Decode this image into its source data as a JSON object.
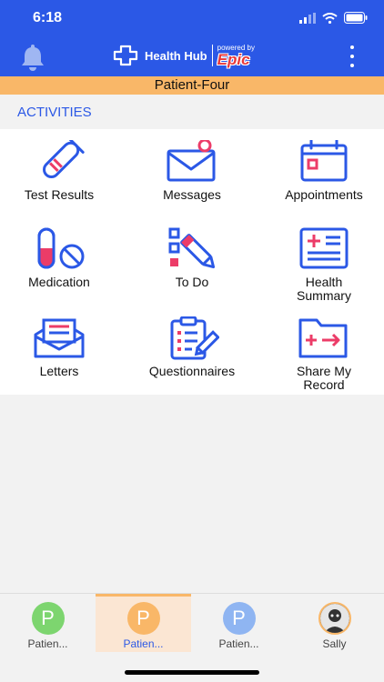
{
  "status_bar": {
    "time": "6:18"
  },
  "header": {
    "app_name": "Health Hub",
    "powered_by": "powered by",
    "brand": "Epic",
    "bell_icon": "bell-icon",
    "menu_icon": "kebab-menu-icon"
  },
  "patient_banner": {
    "name": "Patient-Four"
  },
  "section": {
    "title": "ACTIVITIES"
  },
  "activities": [
    {
      "label": "Test Results",
      "icon": "test-tube-icon"
    },
    {
      "label": "Messages",
      "icon": "envelope-icon"
    },
    {
      "label": "Appointments",
      "icon": "calendar-icon"
    },
    {
      "label": "Medication",
      "icon": "pill-icon"
    },
    {
      "label": "To Do",
      "icon": "checklist-icon"
    },
    {
      "label": "Health Summary",
      "icon": "summary-card-icon"
    },
    {
      "label": "Letters",
      "icon": "letter-icon"
    },
    {
      "label": "Questionnaires",
      "icon": "clipboard-icon"
    },
    {
      "label": "Share My Record",
      "icon": "folder-share-icon"
    }
  ],
  "tabs": [
    {
      "initial": "P",
      "label": "Patien...",
      "color": "#7dd56f",
      "active": false
    },
    {
      "initial": "P",
      "label": "Patien...",
      "color": "#f9b768",
      "active": true
    },
    {
      "initial": "P",
      "label": "Patien...",
      "color": "#8fb5f2",
      "active": false
    },
    {
      "initial": "",
      "label": "Sally",
      "color": "#555555",
      "active": false
    }
  ],
  "colors": {
    "brand_blue": "#2b58e6",
    "accent_pink": "#ec3c68",
    "banner": "#f9b768"
  }
}
